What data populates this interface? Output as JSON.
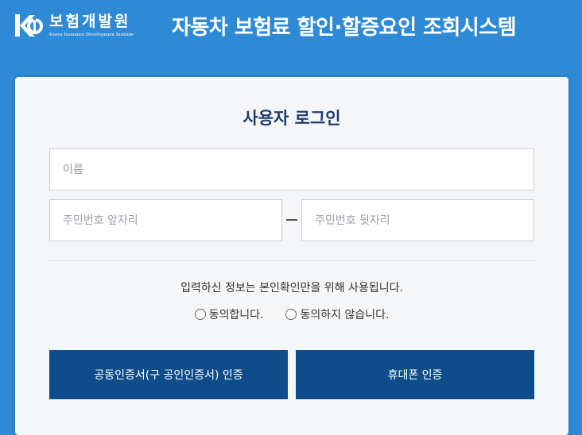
{
  "header": {
    "logo_name": "보험개발원",
    "logo_subtitle": "Korea Insurance Development Institute",
    "title": "자동차 보험료 할인·할증요인 조회시스템"
  },
  "login": {
    "heading": "사용자 로그인",
    "name_placeholder": "이름",
    "rrn_front_placeholder": "주민번호 앞자리",
    "rrn_back_placeholder": "주민번호 뒷자리",
    "notice": "입력하신 정보는 본인확인만을 위해 사용됩니다.",
    "consent_agree": "동의합니다.",
    "consent_disagree": "동의하지 않습니다.",
    "cert_button": "공동인증서(구 공인인증서) 인증",
    "phone_button": "휴대폰 인증"
  },
  "colors": {
    "background": "#2f8ad6",
    "button": "#0f4d8a",
    "heading": "#1f3f6e"
  },
  "icons": {
    "logo": "kidi-logo-icon"
  }
}
